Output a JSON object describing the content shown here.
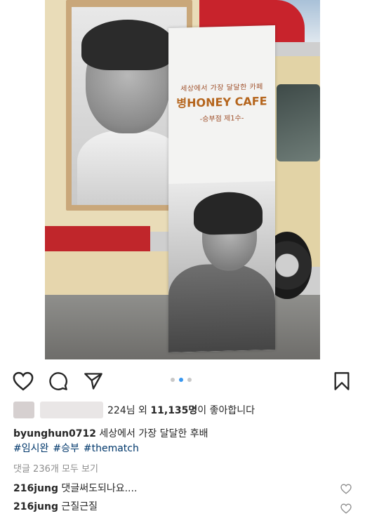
{
  "photo": {
    "banner_subtitle": "세상에서 가장 달달한 카페",
    "banner_title": "병HONEY CAFE",
    "banner_branch": "-승부점 제1수-"
  },
  "actions": {
    "icons": [
      "heart-icon",
      "comment-icon",
      "share-icon",
      "bookmark-icon"
    ],
    "carousel_active_index": 1,
    "carousel_count": 3
  },
  "likes": {
    "prefix_count": "224님",
    "middle": " 외 ",
    "count": "11,135명",
    "suffix": "이 좋아합니다"
  },
  "caption": {
    "username": "byunghun0712",
    "text": " 세상에서 가장 달달한 후배",
    "hashtags": [
      "#임시완",
      "#승부",
      "#thematch"
    ]
  },
  "view_comments": "댓글 236개 모두 보기",
  "comments": [
    {
      "username": "216jung",
      "text": " 댓글써도되나요...."
    },
    {
      "username": "216jung",
      "text": " 근질근질"
    }
  ],
  "colors": {
    "accent": "#3897f0",
    "hashtag": "#00376b",
    "muted": "#8e8e8e"
  }
}
